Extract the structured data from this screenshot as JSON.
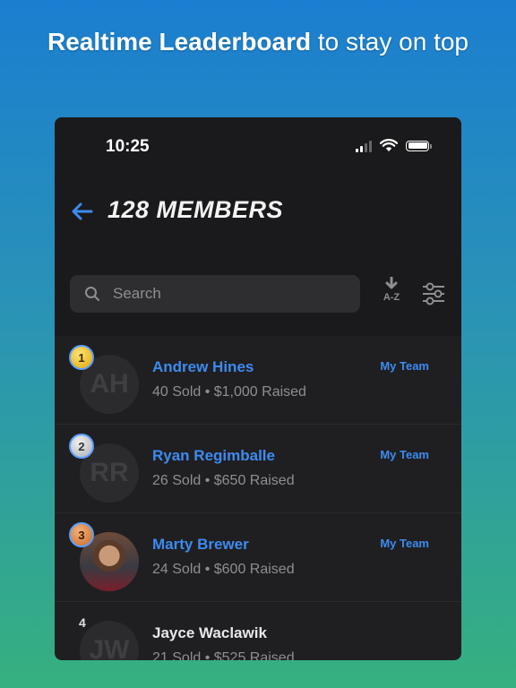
{
  "headline": {
    "bold": "Realtime Leaderboard",
    "rest": " to stay on top"
  },
  "status_bar": {
    "time": "10:25"
  },
  "header": {
    "title": "128 MEMBERS"
  },
  "search": {
    "placeholder": "Search"
  },
  "sort": {
    "label": "A-Z"
  },
  "members": [
    {
      "rank": "1",
      "initials": "AH",
      "name": "Andrew Hines",
      "stats": "40 Sold • $1,000 Raised",
      "team": "My Team"
    },
    {
      "rank": "2",
      "initials": "RR",
      "name": "Ryan Regimballe",
      "stats": "26 Sold • $650 Raised",
      "team": "My Team"
    },
    {
      "rank": "3",
      "initials": "",
      "name": "Marty Brewer",
      "stats": "24 Sold • $600 Raised",
      "team": "My Team"
    },
    {
      "rank": "4",
      "initials": "JW",
      "name": "Jayce Waclawik",
      "stats": "21 Sold • $525 Raised",
      "team": ""
    }
  ],
  "colors": {
    "accent": "#3d8bef",
    "background": "#1f1f22"
  }
}
